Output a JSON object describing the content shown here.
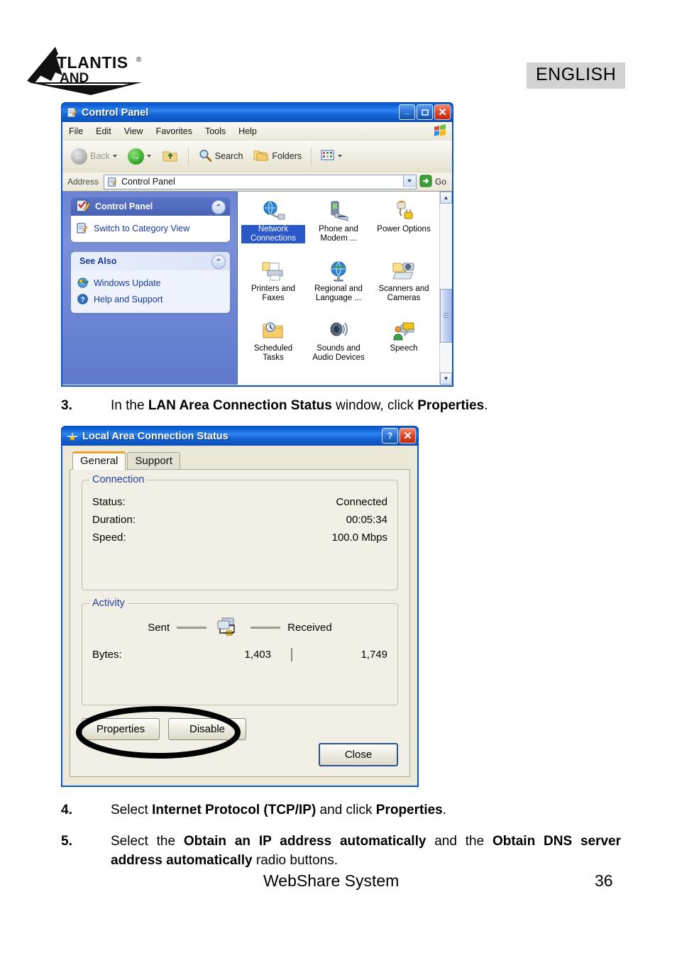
{
  "header": {
    "language_badge": "ENGLISH",
    "logo_main": "ATLANTIS",
    "logo_sub": "LAND",
    "logo_reg": "®"
  },
  "control_panel_window": {
    "title": "Control Panel",
    "title_icon": "control-panel-icon",
    "window_buttons": {
      "minimize": "_",
      "maximize": "□",
      "close": "✕"
    },
    "menu": [
      "File",
      "Edit",
      "View",
      "Favorites",
      "Tools",
      "Help"
    ],
    "toolbar": {
      "back": "Back",
      "forward": "",
      "up": "",
      "search": "Search",
      "folders": "Folders",
      "views": ""
    },
    "address_bar": {
      "label": "Address",
      "value": "Control Panel",
      "go_label": "Go"
    },
    "sidebar": {
      "panels": [
        {
          "title": "Control Panel",
          "style": "blue",
          "items": [
            {
              "label": "Switch to Category View",
              "icon": "switch-view-icon"
            }
          ]
        },
        {
          "title": "See Also",
          "style": "light",
          "items": [
            {
              "label": "Windows Update",
              "icon": "windows-update-icon"
            },
            {
              "label": "Help and Support",
              "icon": "help-support-icon"
            }
          ]
        }
      ]
    },
    "icons": [
      {
        "label": "Network Connections",
        "icon": "network-connections-icon",
        "selected": true
      },
      {
        "label": "Phone and Modem ...",
        "icon": "phone-modem-icon",
        "selected": false
      },
      {
        "label": "Power Options",
        "icon": "power-options-icon",
        "selected": false
      },
      {
        "label": "Printers and Faxes",
        "icon": "printers-faxes-icon",
        "selected": false
      },
      {
        "label": "Regional and Language ...",
        "icon": "regional-language-icon",
        "selected": false
      },
      {
        "label": "Scanners and Cameras",
        "icon": "scanners-cameras-icon",
        "selected": false
      },
      {
        "label": "Scheduled Tasks",
        "icon": "scheduled-tasks-icon",
        "selected": false
      },
      {
        "label": "Sounds and Audio Devices",
        "icon": "sounds-audio-icon",
        "selected": false
      },
      {
        "label": "Speech",
        "icon": "speech-icon",
        "selected": false
      }
    ]
  },
  "steps": {
    "step3": {
      "number": "3.",
      "parts": [
        {
          "t": "In the ",
          "b": false
        },
        {
          "t": "LAN Area Connection Status",
          "b": true
        },
        {
          "t": " window, click ",
          "b": false
        },
        {
          "t": "Properties",
          "b": true
        },
        {
          "t": ".",
          "b": false
        }
      ]
    },
    "step4": {
      "number": "4.",
      "parts": [
        {
          "t": "Select ",
          "b": false
        },
        {
          "t": "Internet Protocol (TCP/IP)",
          "b": true
        },
        {
          "t": " and click ",
          "b": false
        },
        {
          "t": "Properties",
          "b": true
        },
        {
          "t": ".",
          "b": false
        }
      ]
    },
    "step5": {
      "number": "5.",
      "parts": [
        {
          "t": "Select the ",
          "b": false
        },
        {
          "t": "Obtain an IP address automatically",
          "b": true
        },
        {
          "t": " and the ",
          "b": false
        },
        {
          "t": "Obtain DNS server address automatically",
          "b": true
        },
        {
          "t": " radio buttons.",
          "b": false
        }
      ]
    }
  },
  "lan_dialog": {
    "title": "Local Area Connection Status",
    "title_icon": "network-adapter-icon",
    "help_button": "?",
    "close_button": "✕",
    "tabs": [
      {
        "label": "General",
        "active": true
      },
      {
        "label": "Support",
        "active": false
      }
    ],
    "connection_group": {
      "legend": "Connection",
      "rows": [
        {
          "label": "Status:",
          "value": "Connected"
        },
        {
          "label": "Duration:",
          "value": "00:05:34"
        },
        {
          "label": "Speed:",
          "value": "100.0 Mbps"
        }
      ]
    },
    "activity_group": {
      "legend": "Activity",
      "sent_label": "Sent",
      "received_label": "Received",
      "activity_icon": "network-activity-icon",
      "bytes_label": "Bytes:",
      "bytes_sent": "1,403",
      "bytes_received": "1,749"
    },
    "buttons": {
      "properties": "Properties",
      "disable": "Disable",
      "close": "Close"
    },
    "annotation": "hand-drawn-ellipse-around-properties"
  },
  "footer": {
    "product": "WebShare System",
    "page_number": "36"
  },
  "colors": {
    "title_blue": "#0a57c8",
    "badge_gray": "#d2d2d2",
    "selection_blue": "#2a58c8",
    "dialog_face": "#ece9d8",
    "tab_accent": "#f0a22e"
  }
}
